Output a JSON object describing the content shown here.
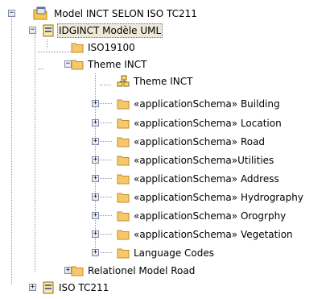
{
  "tree": {
    "root": {
      "label": "Model INCT SELON ISO TC211",
      "expander": "−",
      "icon": "model-root-icon"
    },
    "package": {
      "label": "IDGINCT  Modèle UML",
      "expander": "−",
      "icon": "package-icon"
    },
    "iso19100": {
      "label": "ISO19100",
      "icon": "folder-icon"
    },
    "theme": {
      "label": "Theme INCT",
      "expander": "−",
      "icon": "folder-icon"
    },
    "theme_diagram": {
      "label": "Theme INCT",
      "icon": "diagram-icon"
    },
    "schemas": [
      {
        "label": "«applicationSchema» Building",
        "expander": "+"
      },
      {
        "label": "«applicationSchema» Location",
        "expander": "+"
      },
      {
        "label": "«applicationSchema» Road",
        "expander": "+"
      },
      {
        "label": "«applicationSchema»Utilities",
        "expander": "+"
      },
      {
        "label": "«applicationSchema» Address",
        "expander": "+"
      },
      {
        "label": "«applicationSchema» Hydrography",
        "expander": "+"
      },
      {
        "label": "«applicationSchema» Orogrphy",
        "expander": "+"
      },
      {
        "label": "«applicationSchema» Vegetation",
        "expander": "+"
      },
      {
        "label": "Language Codes",
        "expander": "+"
      }
    ],
    "relational": {
      "label": "Relationel Model Road",
      "expander": "+",
      "icon": "folder-icon"
    },
    "iso_tc211": {
      "label": "ISO TC211",
      "expander": "+",
      "icon": "package-icon"
    }
  }
}
